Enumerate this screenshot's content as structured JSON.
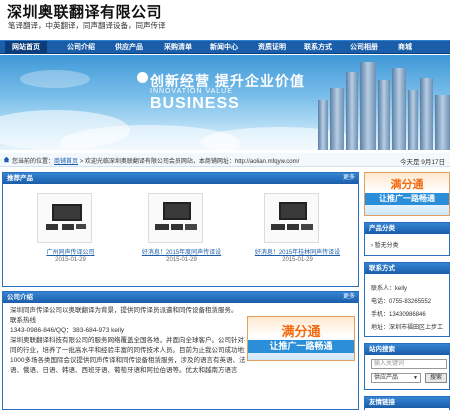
{
  "header": {
    "title": "深圳奥联翻译有限公司",
    "subtitle": "笔译翻译，中英翻译，同声翻译设备，同声传译"
  },
  "nav": [
    {
      "label": "网站首页",
      "active": true
    },
    {
      "label": "公司介绍"
    },
    {
      "label": "供应产品"
    },
    {
      "label": "采购清单"
    },
    {
      "label": "新闻中心"
    },
    {
      "label": "资质证明"
    },
    {
      "label": "联系方式"
    },
    {
      "label": "公司相册"
    },
    {
      "label": "商城"
    }
  ],
  "banner": {
    "line1": "创新经营  提升企业价值",
    "line2": "INNOVATION VALUE",
    "line3": "BUSINESS"
  },
  "infobar": {
    "breadcrumb_prefix": "您当前的位置：",
    "breadcrumb_link": "商铺首页",
    "welcome": " > 欢迎光临深圳奥联翻译有限公司会员网站，本商铺网址：",
    "url": "http://aolian.mfqyw.com/",
    "date": "今天是 9月17日"
  },
  "products_panel": {
    "title": "推荐产品",
    "more": "更多",
    "items": [
      {
        "title": "广州同声传译公司",
        "date": "2015-01-29"
      },
      {
        "title": "好消息！2015年度同声传译设",
        "date": "2015-01-29"
      },
      {
        "title": "好消息！2015年桂林同声传译设",
        "date": "2015-01-29"
      }
    ]
  },
  "intro_panel": {
    "title": "公司介绍",
    "more": "更多",
    "lines": [
      "深圳同声传译公司以奥联翻译为背景，提供同传译员派遣和同传设备租赁服务。",
      "联系热线",
      "1343-0986-846/QQ：383-684-973 kelly",
      "深圳奥联翻译科技有限公司的服务网络覆盖全国各地，并面向全球客户。公司针对不",
      "同的行业，培养了一批高水平和经验丰富的同传技术人员。目前为止我公司成功地为全国",
      "1000多场各类国际会议提供同声传译和同传设备租赁服务，涉及的语言有英语、法语、德",
      "语、俄语、日语、韩语、西班牙语、葡萄牙语和阿拉伯语等。优太和越南方语言"
    ],
    "ad_title": "满分通",
    "ad_sub": "让推广一路畅通"
  },
  "sidebar": {
    "ad_title": "满分通",
    "ad_sub": "让推广一路畅通",
    "category": {
      "title": "产品分类",
      "items": [
        "暂无分类"
      ]
    },
    "contact": {
      "title": "联系方式",
      "items": [
        "联系人：kelly",
        "电话：0755-83265552",
        "手机：13430986846",
        "地址：深圳市福田区上步工"
      ]
    },
    "search": {
      "title": "站内搜索",
      "placeholder": "输入关键词",
      "select_value": "供应产品",
      "button": "搜索"
    },
    "links": {
      "title": "友情链接"
    }
  }
}
